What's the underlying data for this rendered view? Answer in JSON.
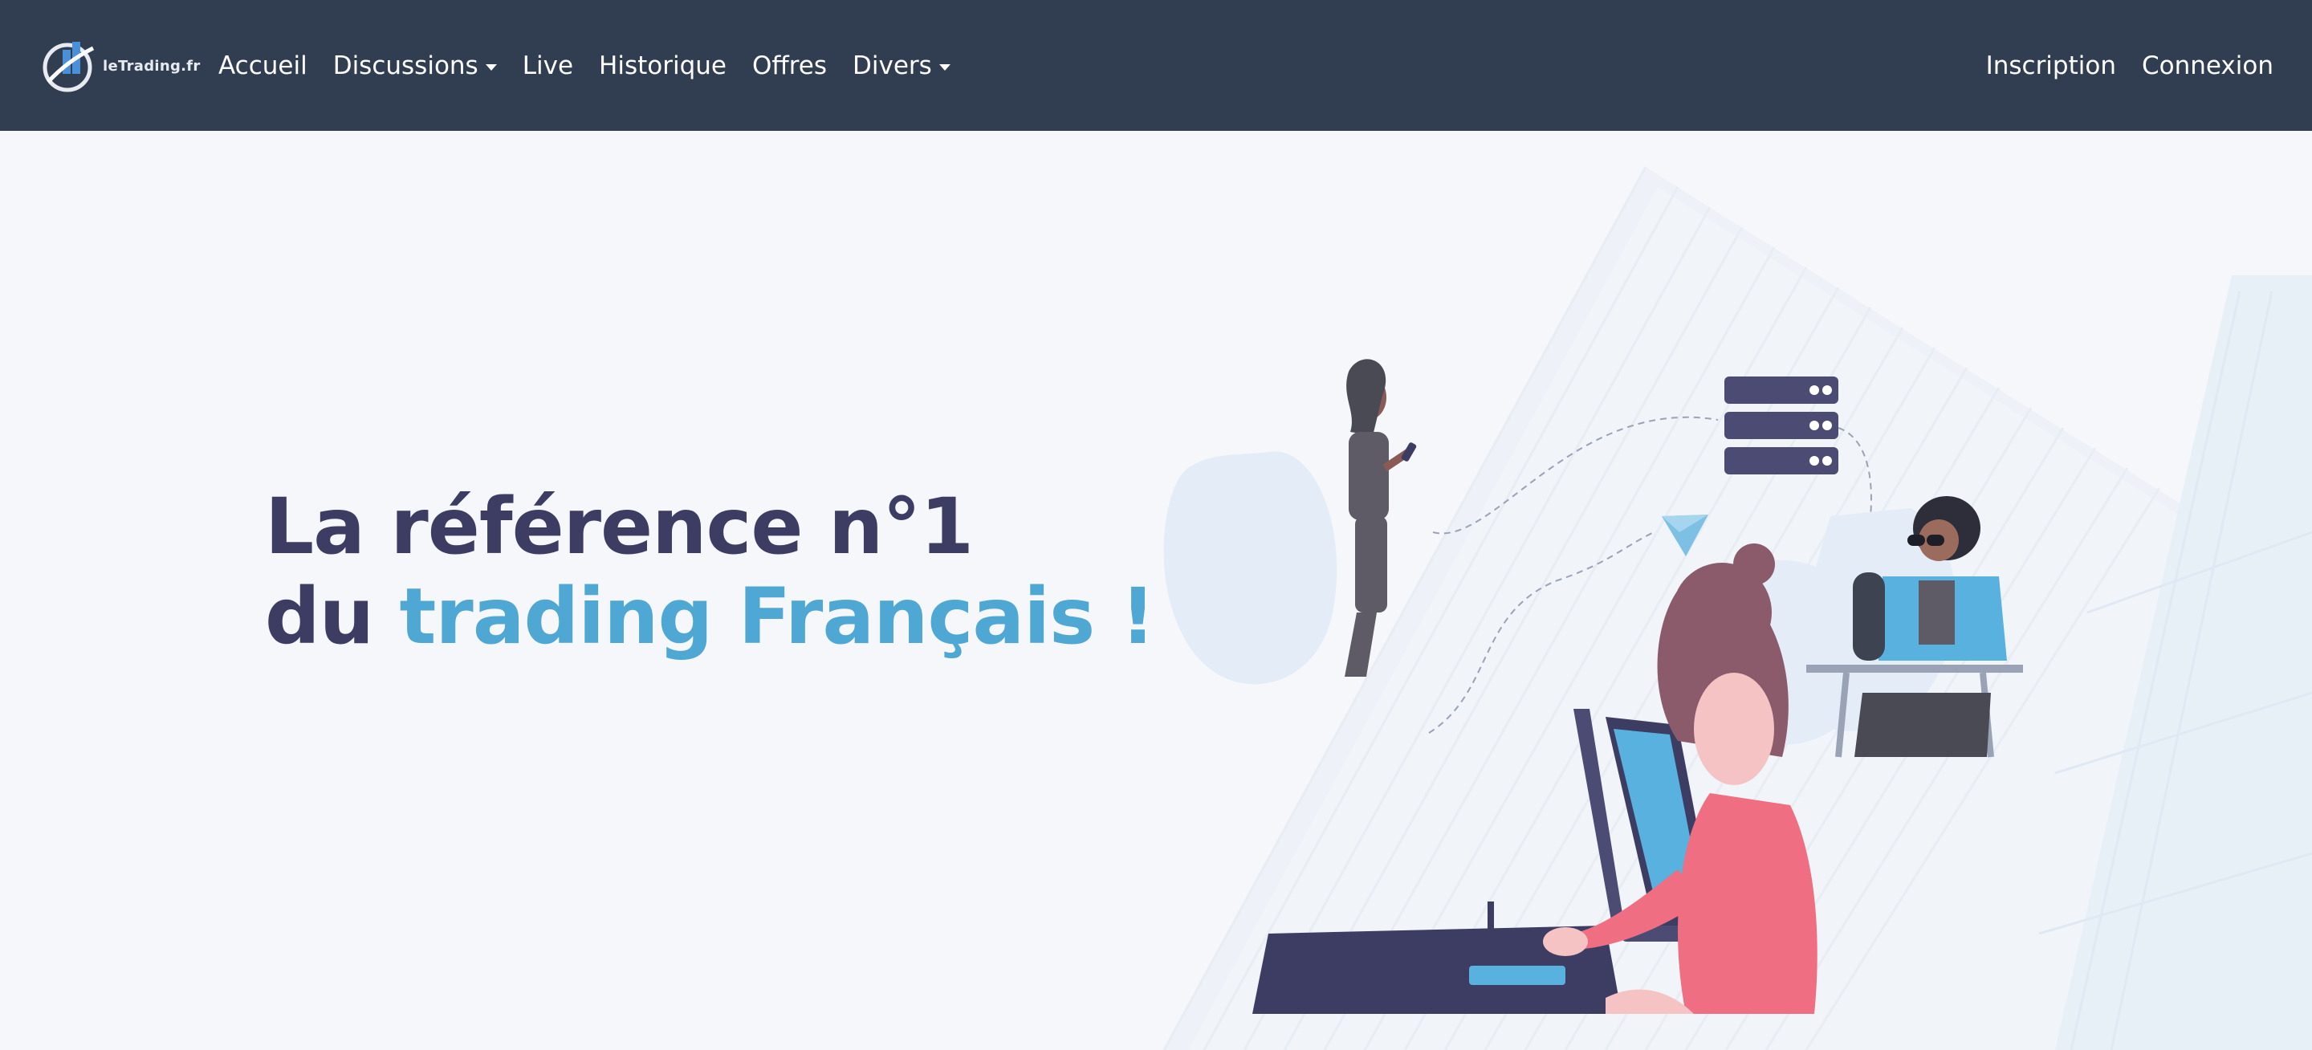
{
  "brand": {
    "name": "leTrading.fr"
  },
  "nav": {
    "left": [
      {
        "label": "Accueil",
        "dropdown": false
      },
      {
        "label": "Discussions",
        "dropdown": true
      },
      {
        "label": "Live",
        "dropdown": false
      },
      {
        "label": "Historique",
        "dropdown": false
      },
      {
        "label": "Offres",
        "dropdown": false
      },
      {
        "label": "Divers",
        "dropdown": true
      }
    ],
    "right": [
      {
        "label": "Inscription"
      },
      {
        "label": "Connexion"
      }
    ]
  },
  "hero": {
    "line1": "La référence n°1",
    "line2_prefix": "du ",
    "line2_accent": "trading Français !"
  },
  "colors": {
    "navbar": "#313d50",
    "background": "#f5f7fb",
    "headline": "#3d3d63",
    "accent": "#4ea8d3"
  },
  "icons": [
    "logo-icon",
    "caret-down-icon"
  ]
}
